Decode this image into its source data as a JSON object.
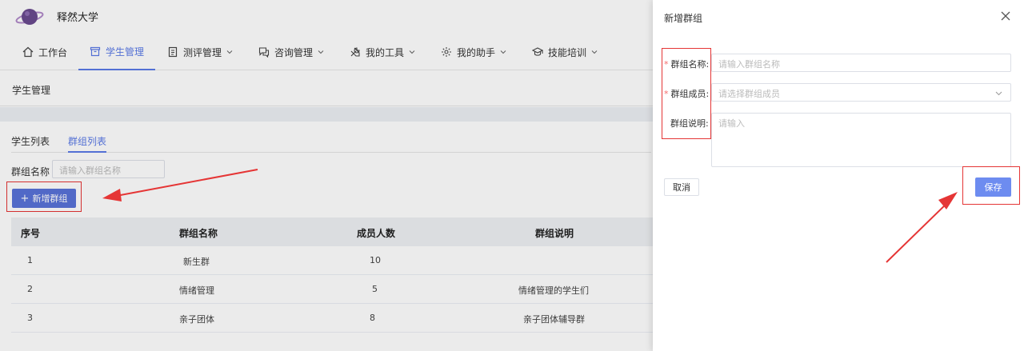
{
  "app": {
    "title": "释然大学"
  },
  "nav": [
    {
      "label": "工作台",
      "icon": "home-icon",
      "has_dropdown": false,
      "active": false
    },
    {
      "label": "学生管理",
      "icon": "box-icon",
      "has_dropdown": false,
      "active": true
    },
    {
      "label": "测评管理",
      "icon": "clipboard-icon",
      "has_dropdown": true,
      "active": false
    },
    {
      "label": "咨询管理",
      "icon": "chat-icon",
      "has_dropdown": true,
      "active": false
    },
    {
      "label": "我的工具",
      "icon": "tools-icon",
      "has_dropdown": true,
      "active": false
    },
    {
      "label": "我的助手",
      "icon": "assistant-icon",
      "has_dropdown": true,
      "active": false
    },
    {
      "label": "技能培训",
      "icon": "graduation-cap-icon",
      "has_dropdown": true,
      "active": false
    }
  ],
  "breadcrumb": "学生管理",
  "tabs": [
    {
      "label": "学生列表",
      "active": false
    },
    {
      "label": "群组列表",
      "active": true
    }
  ],
  "filter": {
    "label": "群组名称",
    "placeholder": "请输入群组名称"
  },
  "add_button": {
    "icon": "plus-icon",
    "label": "新增群组"
  },
  "table": {
    "columns": [
      "序号",
      "群组名称",
      "成员人数",
      "群组说明"
    ],
    "rows": [
      {
        "index": "1",
        "name": "新生群",
        "count": "10",
        "desc": ""
      },
      {
        "index": "2",
        "name": "情绪管理",
        "count": "5",
        "desc": "情绪管理的学生们"
      },
      {
        "index": "3",
        "name": "亲子团体",
        "count": "8",
        "desc": "亲子团体辅导群"
      }
    ]
  },
  "drawer": {
    "title": "新增群组",
    "fields": {
      "name": {
        "label": "群组名称:",
        "required": true,
        "placeholder": "请输入群组名称"
      },
      "members": {
        "label": "群组成员:",
        "required": true,
        "placeholder": "请选择群组成员"
      },
      "desc": {
        "label": "群组说明:",
        "required": false,
        "placeholder": "请输入"
      }
    },
    "cancel_label": "取消",
    "save_label": "保存"
  },
  "colors": {
    "primary": "#5b7ae6",
    "annotation": "#e53535",
    "required": "#f56c6c"
  }
}
